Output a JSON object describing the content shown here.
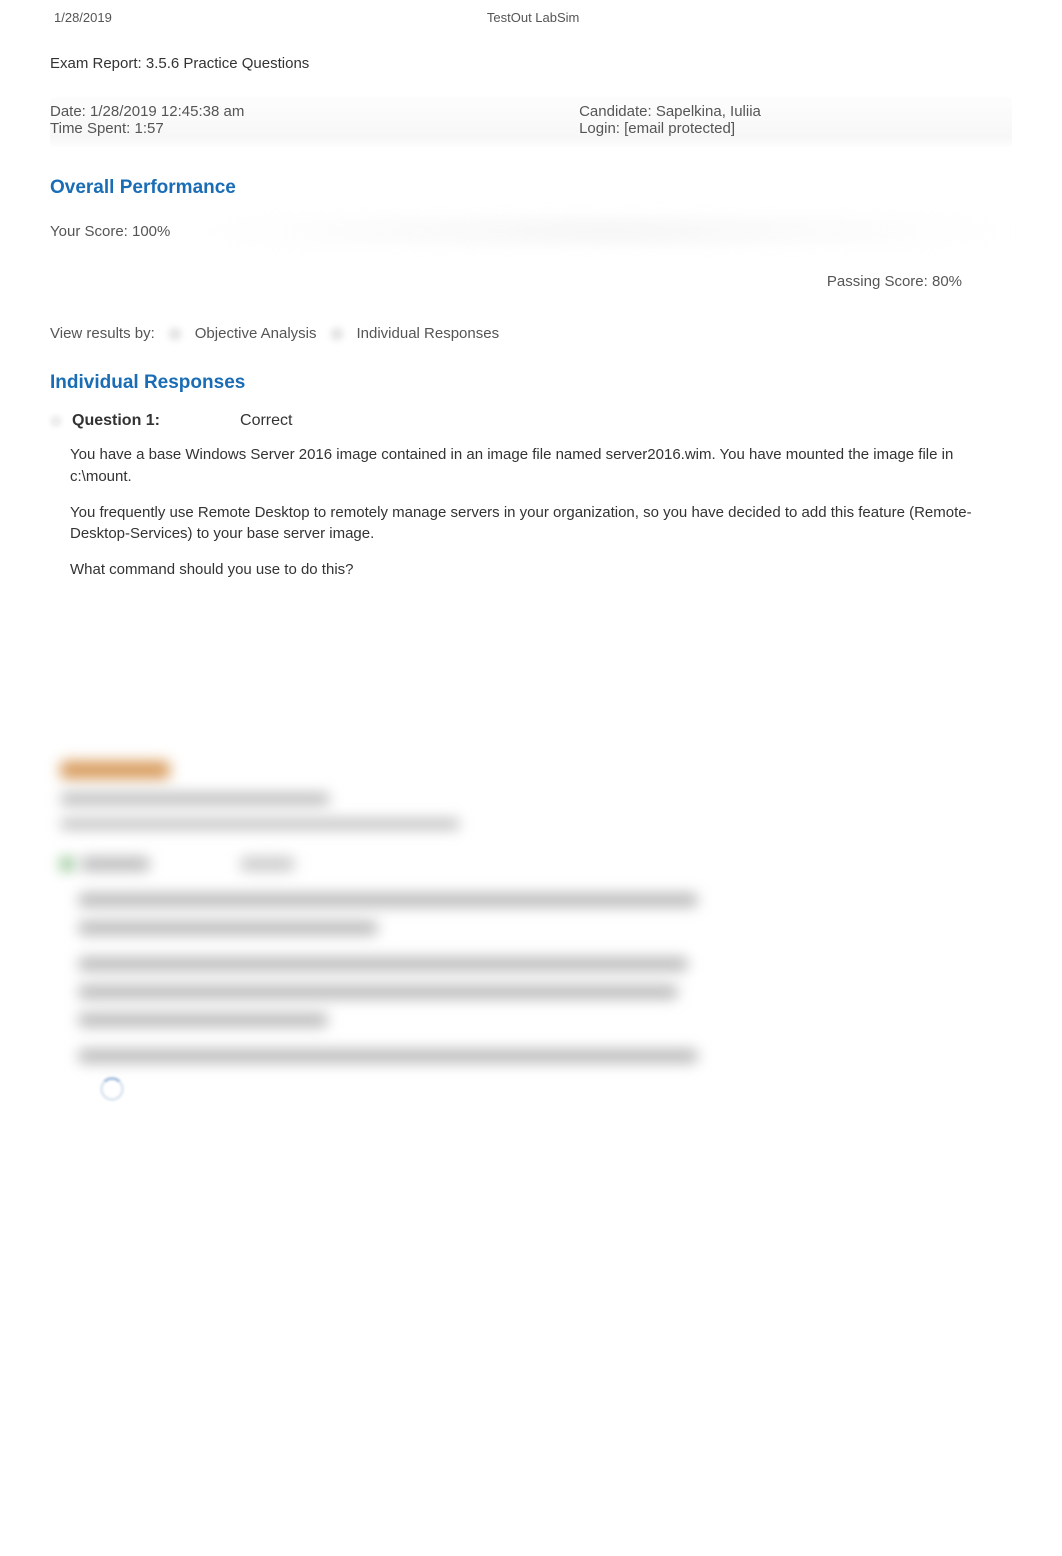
{
  "header": {
    "date": "1/28/2019",
    "app_title": "TestOut LabSim"
  },
  "report": {
    "title": "Exam Report: 3.5.6 Practice Questions",
    "datetime_label": "Date: 1/28/2019 12:45:38 am",
    "time_spent_label": "Time Spent: 1:57",
    "candidate_label": "Candidate: Sapelkina, Iuliia",
    "login_label": "Login: [email protected]"
  },
  "performance": {
    "heading": "Overall Performance",
    "score_label": "Your Score: 100%",
    "passing_label": "Passing Score: 80%"
  },
  "filter": {
    "label": "View results by:",
    "option1": "Objective Analysis",
    "option2": "Individual Responses"
  },
  "responses": {
    "heading": "Individual Responses",
    "q1": {
      "title": "Question 1:",
      "status": "Correct",
      "p1": "You have a base Windows Server 2016 image contained in an image file named server2016.wim. You have mounted the image file in c:\\mount.",
      "p2": "You frequently use Remote Desktop to remotely manage servers in your organization, so you have decided to add this feature (Remote-Desktop-Services) to your base server image.",
      "p3": "What command should you use to do this?"
    }
  }
}
